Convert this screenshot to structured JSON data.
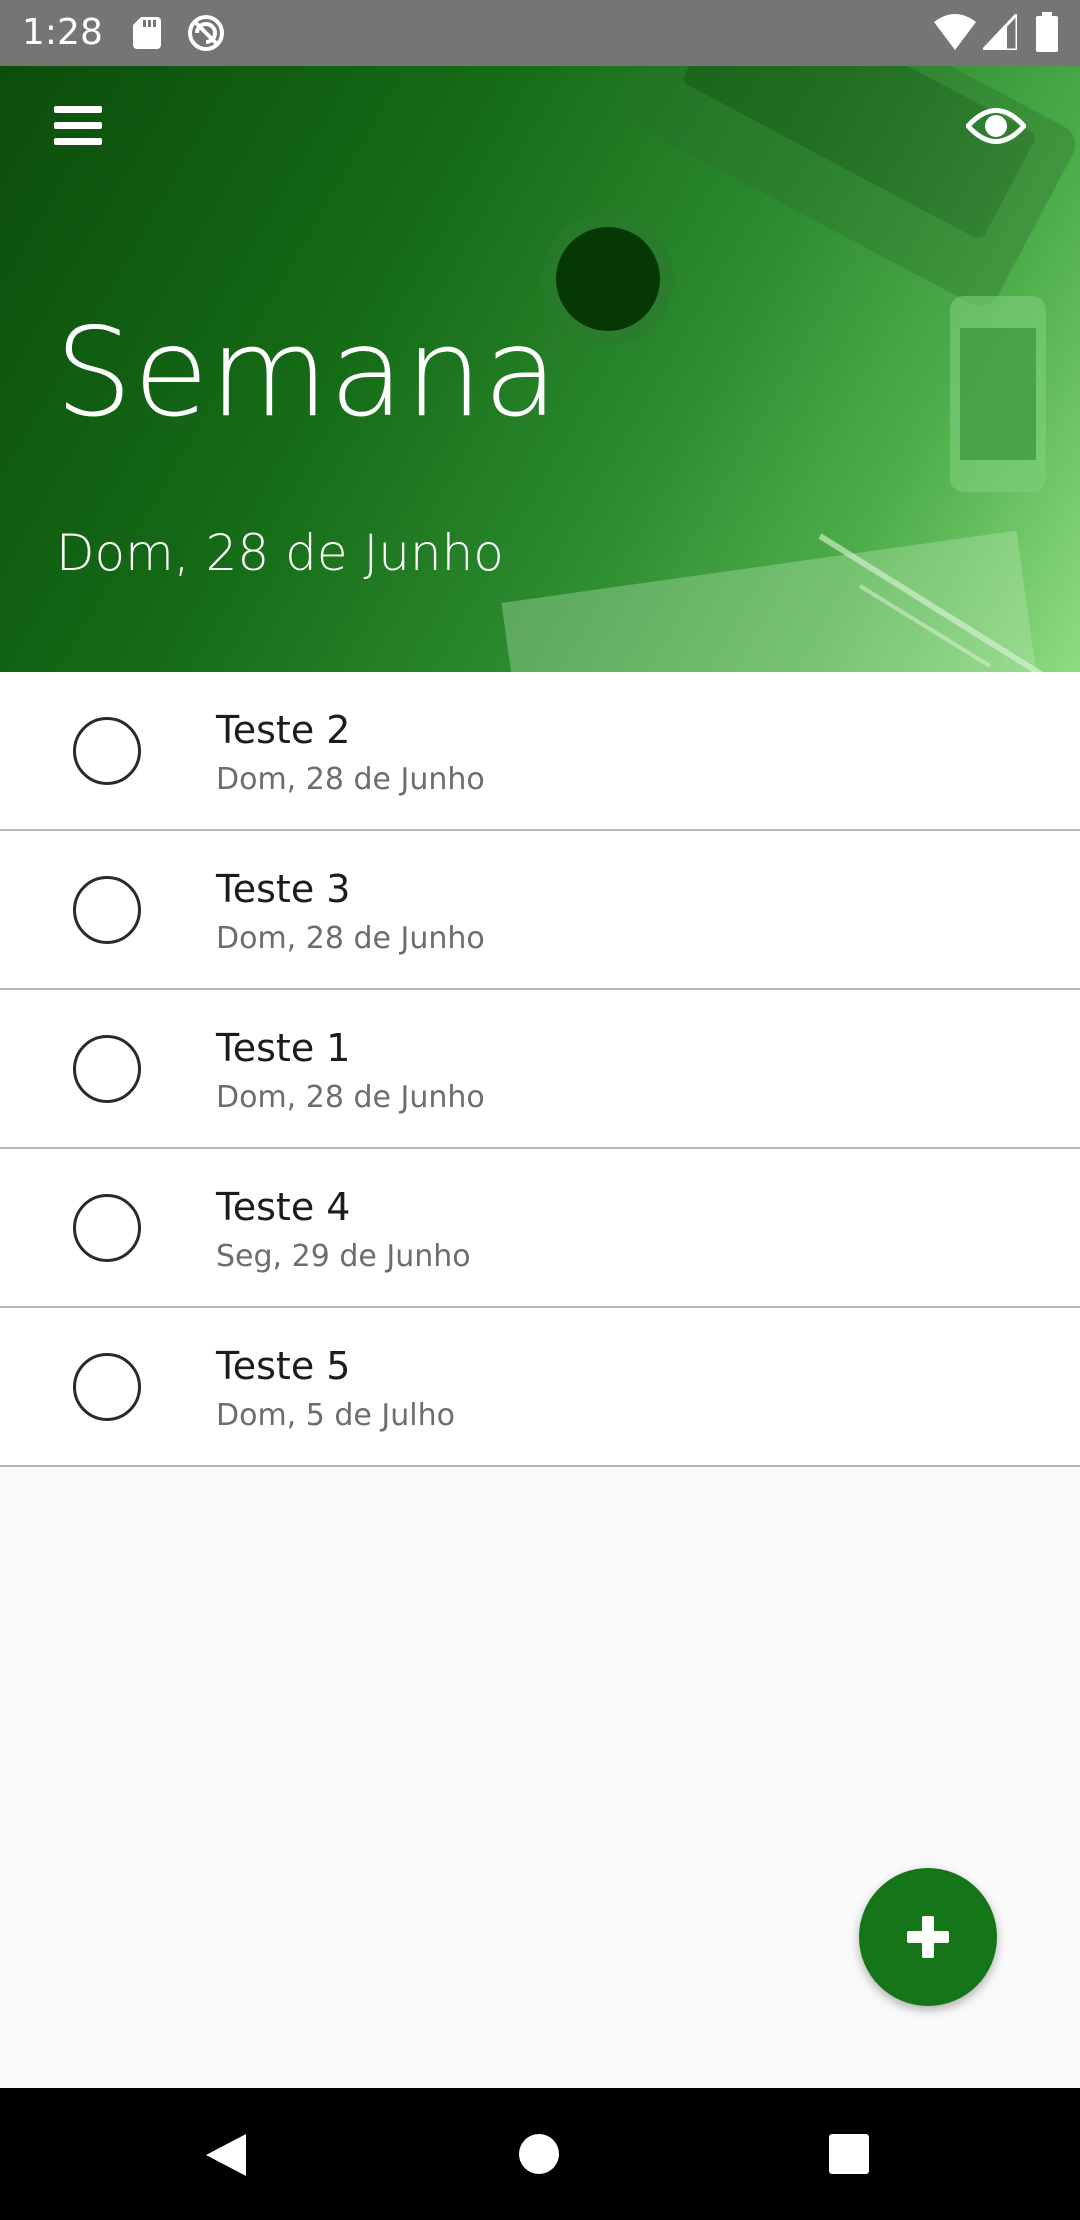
{
  "status_bar": {
    "time": "1:28",
    "icons": [
      "sd-card-icon",
      "sync-icon",
      "wifi-icon",
      "cell-signal-icon",
      "battery-icon"
    ]
  },
  "header": {
    "title": "Semana",
    "date": "Dom, 28 de Junho",
    "menu_icon": "menu-icon",
    "visibility_icon": "eye-icon"
  },
  "tasks": [
    {
      "name": "Teste 2",
      "date": "Dom, 28 de Junho",
      "completed": false
    },
    {
      "name": "Teste 3",
      "date": "Dom, 28 de Junho",
      "completed": false
    },
    {
      "name": "Teste 1",
      "date": "Dom, 28 de Junho",
      "completed": false
    },
    {
      "name": "Teste 4",
      "date": "Seg, 29 de Junho",
      "completed": false
    },
    {
      "name": "Teste 5",
      "date": "Dom, 5 de Julho",
      "completed": false
    }
  ],
  "fab": {
    "icon": "plus-icon"
  },
  "nav_bar": {
    "icons": [
      "back-icon",
      "home-icon",
      "recents-icon"
    ]
  },
  "colors": {
    "status_bar": "#757575",
    "header_dark": "#0c4d0c",
    "header_light": "#8fdc82",
    "fab": "#157519",
    "background": "#fafafa",
    "divider": "#b5b5b5"
  }
}
